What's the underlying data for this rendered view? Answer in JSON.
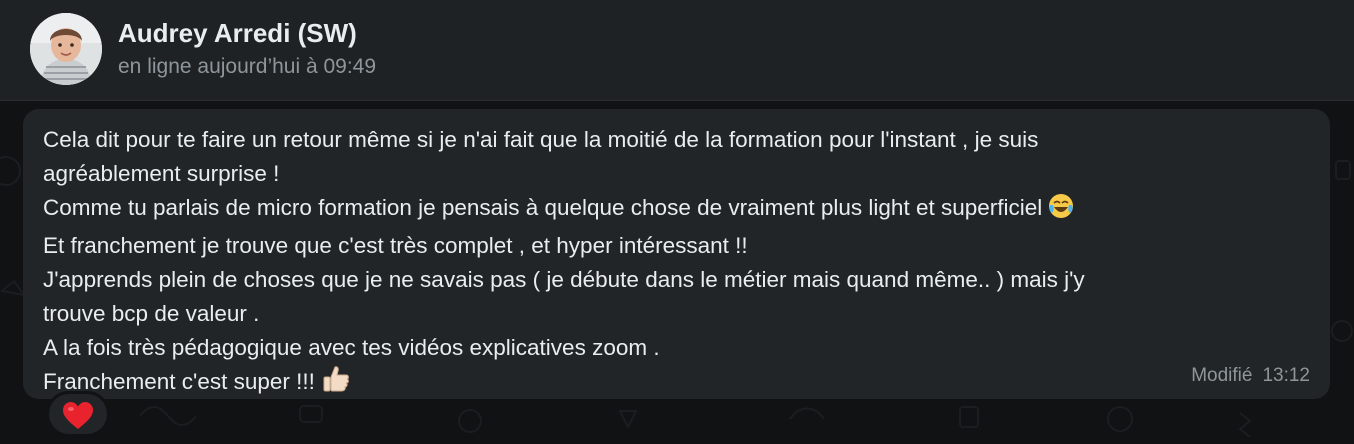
{
  "contact": {
    "name": "Audrey Arredi (SW)",
    "status": "en ligne aujourd’hui à 09:49"
  },
  "message": {
    "lines": [
      "Cela dit pour te faire un retour même si je n'ai fait que la moitié de la formation pour l'instant , je suis",
      "agréablement surprise !",
      "Comme tu parlais de micro formation je pensais à quelque chose de vraiment plus light et superficiel",
      "Et franchement je trouve que c'est très complet , et hyper intéressant !!",
      "J'apprends plein de choses que je ne savais pas ( je débute dans le métier mais quand même..  ) mais j'y",
      "trouve bcp de valeur .",
      "A la fois très pédagogique avec tes vidéos explicatives zoom .",
      "Franchement c'est super !!!"
    ],
    "emojis": {
      "line3": "laughing-tears-emoji",
      "line8": "thumbs-up-emoji"
    },
    "edited_label": "Modifié",
    "time": "13:12"
  },
  "reaction": {
    "emoji": "red-heart-emoji"
  },
  "colors": {
    "header_bg": "#1f2224",
    "chat_bg": "#101213",
    "bubble_bg": "#222527",
    "text": "#e9edef",
    "secondary_text": "#8e969b"
  }
}
